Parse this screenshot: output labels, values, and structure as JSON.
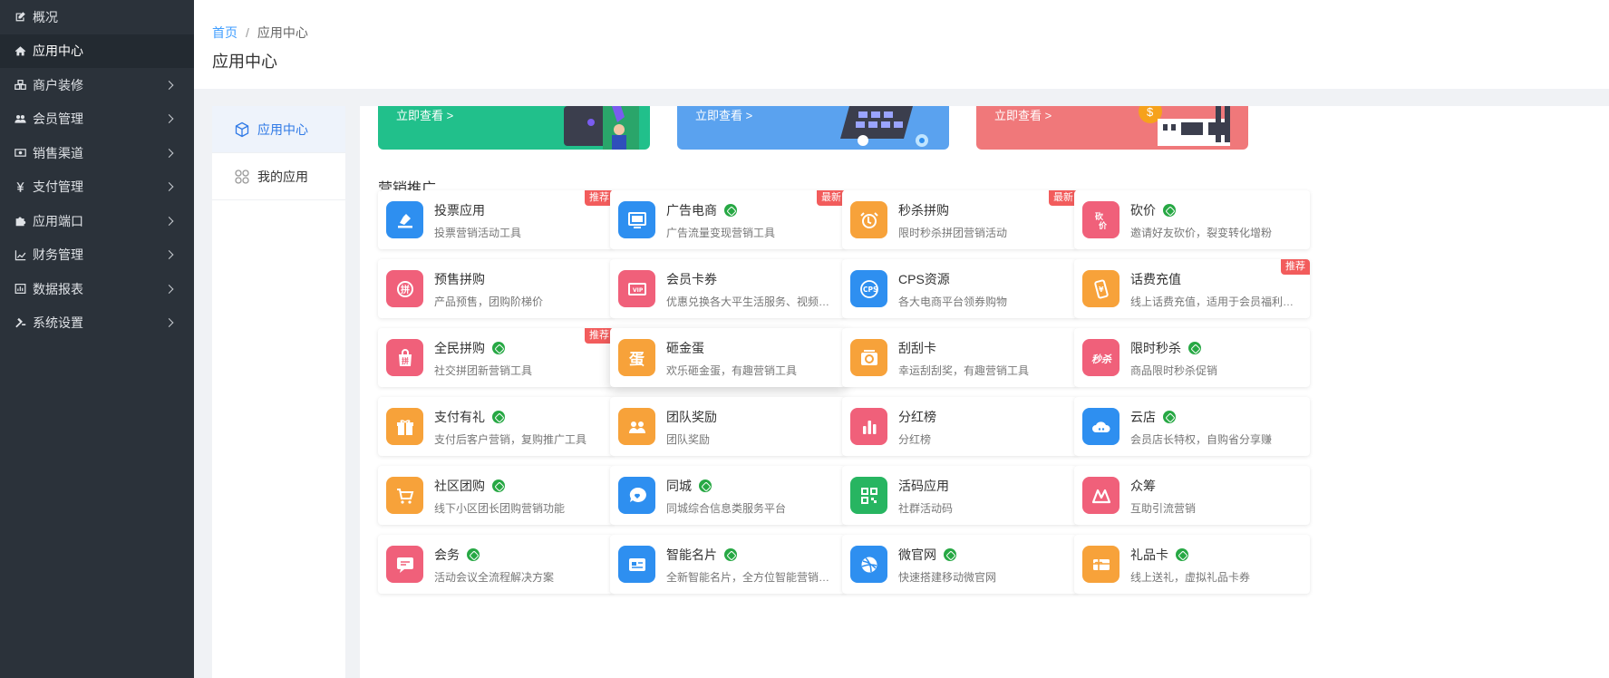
{
  "sidebar": {
    "items": [
      {
        "label": "概况",
        "icon": "edit-icon",
        "chevron": false
      },
      {
        "label": "应用中心",
        "icon": "home-icon",
        "chevron": false,
        "active": true
      },
      {
        "label": "商户装修",
        "icon": "cubes-icon",
        "chevron": true
      },
      {
        "label": "会员管理",
        "icon": "users-icon",
        "chevron": true
      },
      {
        "label": "销售渠道",
        "icon": "money-icon",
        "chevron": true
      },
      {
        "label": "支付管理",
        "icon": "yen-icon",
        "chevron": true
      },
      {
        "label": "应用端口",
        "icon": "puzzle-icon",
        "chevron": true
      },
      {
        "label": "财务管理",
        "icon": "line-chart-icon",
        "chevron": true
      },
      {
        "label": "数据报表",
        "icon": "report-icon",
        "chevron": true
      },
      {
        "label": "系统设置",
        "icon": "gavel-icon",
        "chevron": true
      }
    ]
  },
  "breadcrumb": {
    "home": "首页",
    "sep": "/",
    "current": "应用中心"
  },
  "page_title": "应用中心",
  "submenu": [
    {
      "label": "应用中心",
      "icon": "cube-icon",
      "active": true
    },
    {
      "label": "我的应用",
      "icon": "apps-grid-icon",
      "active": false
    }
  ],
  "banners": [
    {
      "label": "立即查看 >",
      "color": "#21c08b"
    },
    {
      "label": "立即查看 >",
      "color": "#5aa2ef"
    },
    {
      "label": "立即查看 >",
      "color": "#f0787a"
    }
  ],
  "section_title": "营销推广",
  "apps": [
    {
      "name": "投票应用",
      "desc": "投票营销活动工具",
      "icon": "vote-icon",
      "color": "#2e8ff0",
      "badge": "推荐",
      "link": false
    },
    {
      "name": "广告电商",
      "desc": "广告流量变现营销工具",
      "icon": "monitor-icon",
      "color": "#2e8ff0",
      "badge": "最新",
      "link": true
    },
    {
      "name": "秒杀拼购",
      "desc": "限时秒杀拼团营销活动",
      "icon": "alarm-icon",
      "color": "#f7a23a",
      "badge": "最新",
      "link": false
    },
    {
      "name": "砍价",
      "desc": "邀请好友砍价，裂变转化增粉",
      "icon": "bargain-icon",
      "color": "#f0607a",
      "badge": "",
      "link": true
    },
    {
      "name": "预售拼购",
      "desc": "产品预售，团购阶梯价",
      "icon": "pin-icon",
      "color": "#f0607a",
      "badge": "",
      "link": false
    },
    {
      "name": "会员卡券",
      "desc": "优惠兑换各大平生活服务、视频会员",
      "icon": "vip-ticket-icon",
      "color": "#f0607a",
      "badge": "",
      "link": false
    },
    {
      "name": "CPS资源",
      "desc": "各大电商平台领券购物",
      "icon": "cps-icon",
      "color": "#2e8ff0",
      "badge": "",
      "link": false
    },
    {
      "name": "话费充值",
      "desc": "线上话费充值，适用于会员福利发放",
      "icon": "phone-recharge-icon",
      "color": "#f7a23a",
      "badge": "推荐",
      "link": false
    },
    {
      "name": "全民拼购",
      "desc": "社交拼团新营销工具",
      "icon": "shopping-bag-icon",
      "color": "#f0607a",
      "badge": "推荐",
      "link": true
    },
    {
      "name": "砸金蛋",
      "desc": "欢乐砸金蛋，有趣营销工具",
      "icon": "egg-icon",
      "color": "#f7a23a",
      "badge": "",
      "link": false
    },
    {
      "name": "刮刮卡",
      "desc": "幸运刮刮奖，有趣营销工具",
      "icon": "scratch-card-icon",
      "color": "#f7a23a",
      "badge": "",
      "link": false
    },
    {
      "name": "限时秒杀",
      "desc": "商品限时秒杀促销",
      "icon": "flash-sale-icon",
      "color": "#f0607a",
      "badge": "",
      "link": true
    },
    {
      "name": "支付有礼",
      "desc": "支付后客户营销，复购推广工具",
      "icon": "gift-icon",
      "color": "#f7a23a",
      "badge": "",
      "link": true
    },
    {
      "name": "团队奖励",
      "desc": "团队奖励",
      "icon": "team-icon",
      "color": "#f7a23a",
      "badge": "",
      "link": false
    },
    {
      "name": "分红榜",
      "desc": "分红榜",
      "icon": "bar-chart-icon",
      "color": "#f0607a",
      "badge": "",
      "link": false
    },
    {
      "name": "云店",
      "desc": "会员店长特权，自购省分享赚",
      "icon": "cloud-icon",
      "color": "#2e8ff0",
      "badge": "",
      "link": true
    },
    {
      "name": "社区团购",
      "desc": "线下小区团长团购营销功能",
      "icon": "cart-icon",
      "color": "#f7a23a",
      "badge": "",
      "link": true
    },
    {
      "name": "同城",
      "desc": "同城综合信息类服务平台",
      "icon": "chat-heart-icon",
      "color": "#2e8ff0",
      "badge": "",
      "link": true
    },
    {
      "name": "活码应用",
      "desc": "社群活动码",
      "icon": "qrcode-icon",
      "color": "#27b561",
      "badge": "",
      "link": false
    },
    {
      "name": "众筹",
      "desc": "互助引流营销",
      "icon": "crowdfunding-icon",
      "color": "#f0607a",
      "badge": "",
      "link": false
    },
    {
      "name": "会务",
      "desc": "活动会议全流程解决方案",
      "icon": "message-icon",
      "color": "#f0607a",
      "badge": "",
      "link": true
    },
    {
      "name": "智能名片",
      "desc": "全新智能名片，全方位智能营销工具",
      "icon": "business-card-icon",
      "color": "#2e8ff0",
      "badge": "",
      "link": true
    },
    {
      "name": "微官网",
      "desc": "快速搭建移动微官网",
      "icon": "dribbble-icon",
      "color": "#2e8ff0",
      "badge": "",
      "link": true
    },
    {
      "name": "礼品卡",
      "desc": "线上送礼，虚拟礼品卡券",
      "icon": "gift-card-icon",
      "color": "#f7a23a",
      "badge": "",
      "link": true
    }
  ]
}
